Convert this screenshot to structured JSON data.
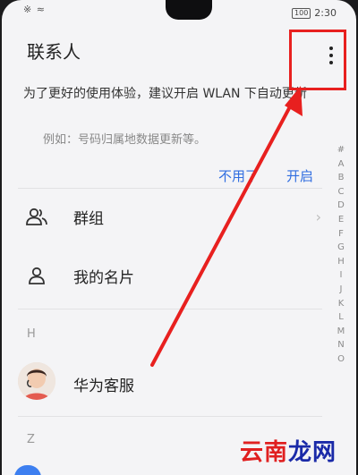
{
  "status": {
    "time": "2:30",
    "battery": "100"
  },
  "header": {
    "title": "联系人"
  },
  "notice": {
    "message": "为了更好的使用体验，建议开启 WLAN 下自动更新",
    "example": "例如：号码归属地数据更新等。",
    "dismiss_label": "不用了",
    "enable_label": "开启"
  },
  "rows": {
    "groups_label": "群组",
    "my_card_label": "我的名片"
  },
  "sections": {
    "h": "H",
    "z": "Z"
  },
  "contacts": [
    {
      "name": "华为客服"
    }
  ],
  "index_letters": [
    "#",
    "A",
    "B",
    "C",
    "D",
    "E",
    "F",
    "G",
    "H",
    "I",
    "J",
    "K",
    "L",
    "M",
    "N",
    "O"
  ],
  "watermark": {
    "text_a": "云南",
    "text_b": "龙网",
    "color_a": "#e02020",
    "color_b": "#1a2aa8"
  },
  "colors": {
    "accent": "#2f6de0",
    "annotation": "#e8201f"
  }
}
